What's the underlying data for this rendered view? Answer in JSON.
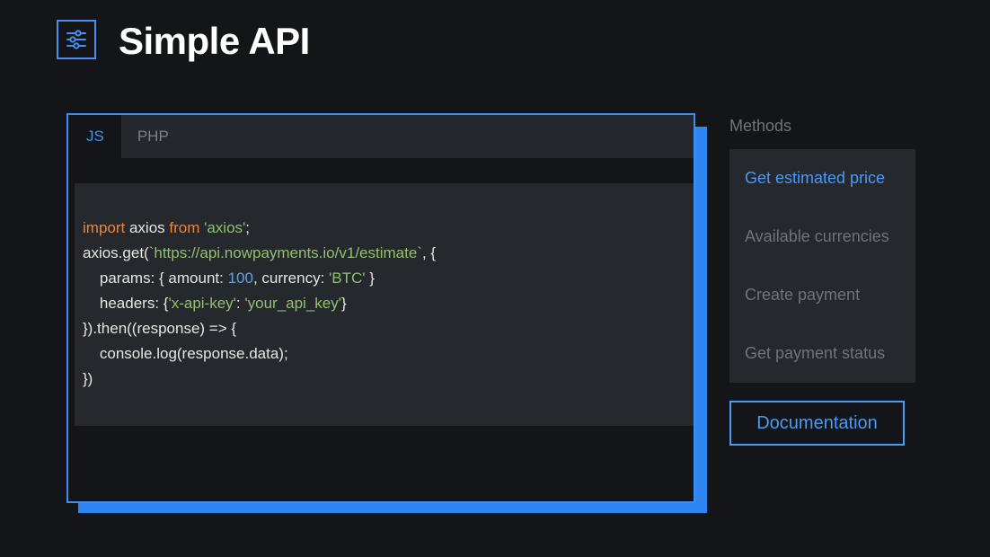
{
  "header": {
    "title": "Simple API",
    "icon": "sliders-icon"
  },
  "colors": {
    "accent": "#3d8ef2",
    "background": "#131519",
    "panel": "#25282c"
  },
  "code_panel": {
    "tabs": [
      {
        "label": "JS",
        "active": true
      },
      {
        "label": "PHP",
        "active": false
      }
    ],
    "code": {
      "line1": {
        "kw1": "import",
        "t1": " axios ",
        "kw2": "from",
        "t2": " ",
        "s1": "'axios'",
        "t3": ";"
      },
      "line2": {
        "t1": "axios.get(",
        "s1": "`https://api.nowpayments.io/v1/estimate`",
        "t2": ", {"
      },
      "line3": {
        "t1": "    params: { amount: ",
        "n1": "100",
        "t2": ", currency: ",
        "s1": "'BTC'",
        "t3": " }"
      },
      "line4": {
        "t1": "    headers: {",
        "s1": "'x-api-key'",
        "t2": ": ",
        "s2": "'your_api_key'",
        "t3": "}"
      },
      "line5": {
        "t1": "}).then((response) => {"
      },
      "line6": {
        "t1": "    console.log(response.data);"
      },
      "line7": {
        "t1": "})"
      }
    }
  },
  "methods": {
    "label": "Methods",
    "items": [
      {
        "label": "Get estimated price",
        "active": true
      },
      {
        "label": "Available currencies",
        "active": false
      },
      {
        "label": "Create payment",
        "active": false
      },
      {
        "label": "Get payment status",
        "active": false
      }
    ]
  },
  "documentation_button": {
    "label": "Documentation"
  }
}
